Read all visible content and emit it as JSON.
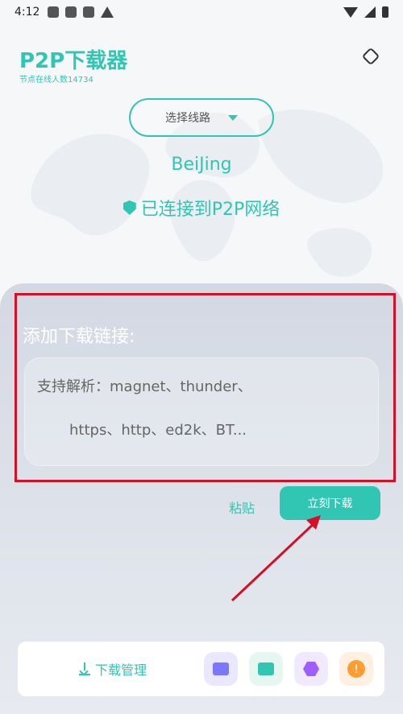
{
  "status_bar": {
    "time": "4:12"
  },
  "header": {
    "title": "P2P下载器",
    "subtitle": "节点在线人数14734"
  },
  "route": {
    "label": "选择线路"
  },
  "location": {
    "city": "BeiJing"
  },
  "connection": {
    "status": "已连接到P2P网络"
  },
  "add_link": {
    "title": "添加下载链接:",
    "placeholder_line1": "支持解析：magnet、thunder、",
    "placeholder_line2": "https、http、ed2k、BT..."
  },
  "actions": {
    "paste": "粘贴",
    "download_now": "立刻下载"
  },
  "bottom_bar": {
    "download_manager": "下载管理"
  },
  "icons": {
    "settings": "settings-icon",
    "chevron": "chevron-down-icon",
    "shield": "shield-check-icon",
    "download": "download-icon",
    "folder_a": "folder-icon",
    "folder_b": "folder-icon",
    "hexagon": "hexagon-icon",
    "warning": "warning-icon"
  },
  "colors": {
    "accent": "#31c6b4",
    "highlight": "#d50f24"
  }
}
